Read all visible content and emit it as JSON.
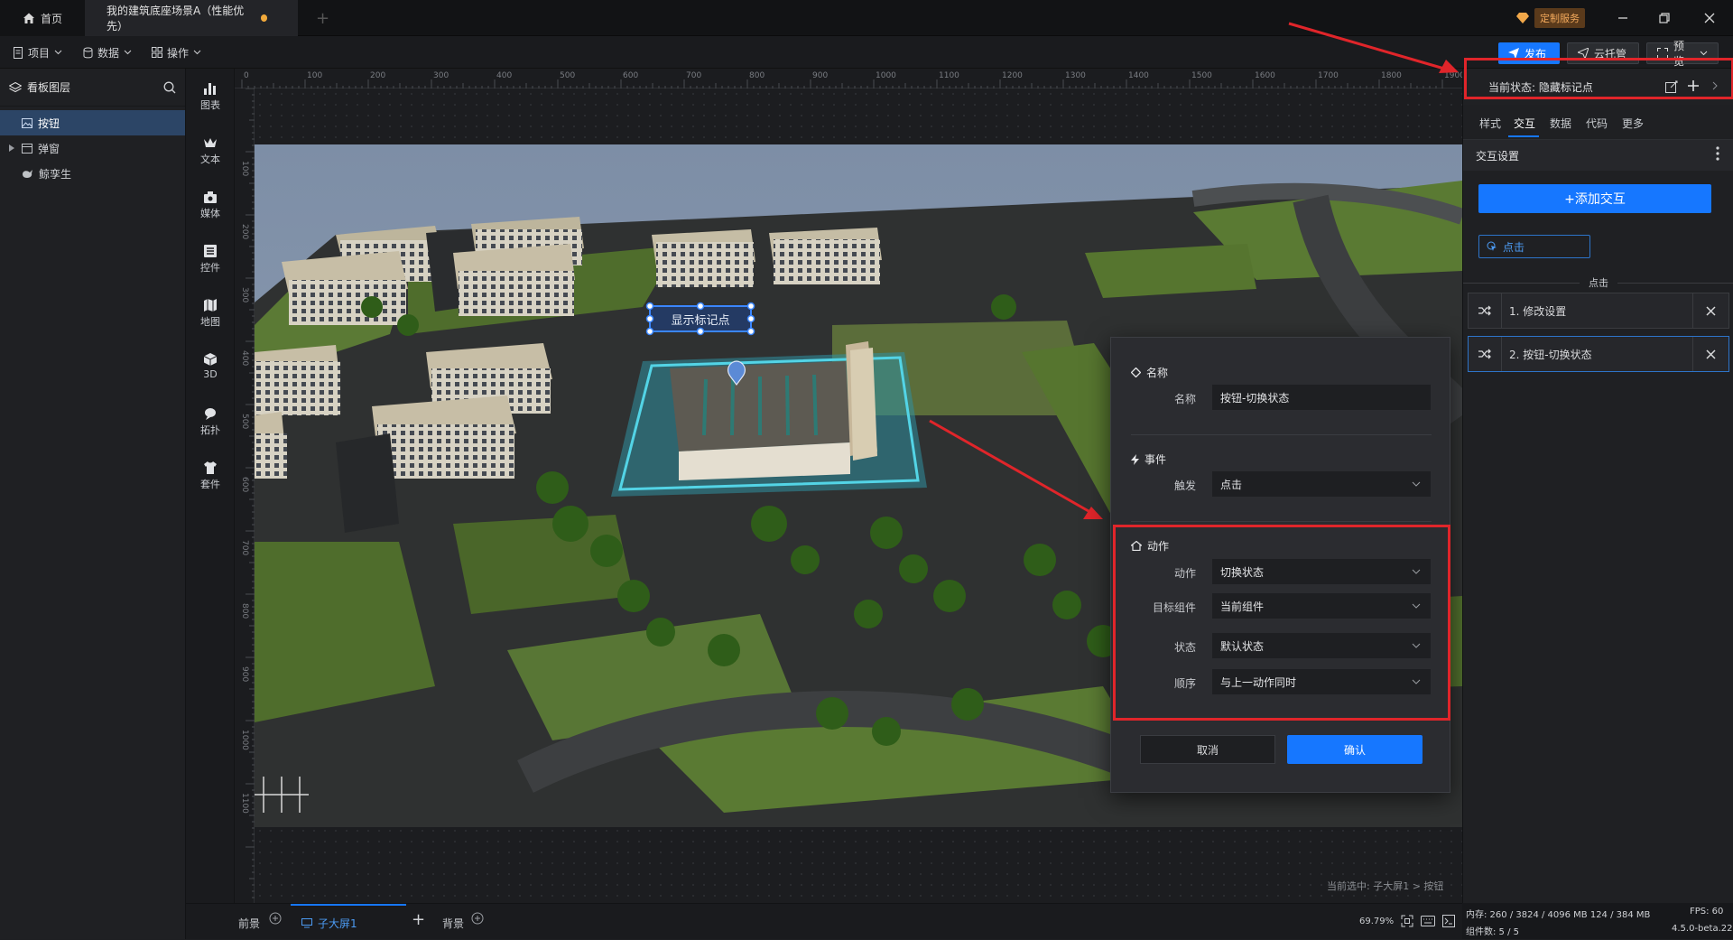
{
  "titlebar": {
    "home_label": "首页",
    "doc_tab": "我的建筑底座场景A（性能优先）",
    "new_tab": "+",
    "service_label": "定制服务"
  },
  "menubar": {
    "project": "项目",
    "data": "数据",
    "operation": "操作",
    "publish": "发布",
    "cloud": "云托管",
    "preview": "预览"
  },
  "layers": {
    "title": "看板图层",
    "items": [
      {
        "label": "按钮",
        "selected": true
      },
      {
        "label": "弹窗",
        "selected": false
      },
      {
        "label": "鲸孪生",
        "selected": false
      }
    ]
  },
  "tools": [
    "图表",
    "文本",
    "媒体",
    "控件",
    "地图",
    "3D",
    "拓扑",
    "套件"
  ],
  "ruler": {
    "h_ticks": [
      "0",
      "100",
      "200",
      "300",
      "400",
      "500",
      "600",
      "700",
      "800",
      "900",
      "1000",
      "1100",
      "1200",
      "1300",
      "1400",
      "1500",
      "1600",
      "1700",
      "1800",
      "1900"
    ],
    "v_ticks": [
      "100",
      "200",
      "300",
      "400",
      "500",
      "600",
      "700",
      "800",
      "900",
      "1000",
      "1100"
    ]
  },
  "scene": {
    "marker_label": "显示标记点"
  },
  "canvas": {
    "selection_info": "当前选中: 子大屏1 > 按钮"
  },
  "bottom": {
    "foreground": "前景",
    "screen_tab": "子大屏1",
    "add": "+",
    "background": "背景",
    "zoom": "69.79%"
  },
  "status": {
    "memory": "内存:  260 / 3824 / 4096 MB  124 / 384 MB",
    "fps": "FPS:  60",
    "components": "组件数: 5 / 5",
    "version": "4.5.0-beta.22"
  },
  "right_panel": {
    "current_state": "当前状态:  隐藏标记点",
    "tabs": [
      "样式",
      "交互",
      "数据",
      "代码",
      "更多"
    ],
    "active_tab": "交互",
    "section_title": "交互设置",
    "add_interaction": "+添加交互",
    "trigger_tag": "点击",
    "group_title": "点击",
    "actions": [
      "1. 修改设置",
      "2. 按钮-切换状态"
    ]
  },
  "dialog": {
    "name_section": "名称",
    "name_label": "名称",
    "name_value": "按钮-切换状态",
    "event_section": "事件",
    "trigger_label": "触发",
    "trigger_value": "点击",
    "action_section": "动作",
    "action_label": "动作",
    "action_value": "切换状态",
    "target_label": "目标组件",
    "target_value": "当前组件",
    "state_label": "状态",
    "state_value": "默认状态",
    "order_label": "顺序",
    "order_value": "与上一动作同时",
    "cancel": "取消",
    "confirm": "确认"
  },
  "colors": {
    "accent": "#1677ff",
    "highlight": "#e0252a",
    "panel": "#1f2023"
  }
}
